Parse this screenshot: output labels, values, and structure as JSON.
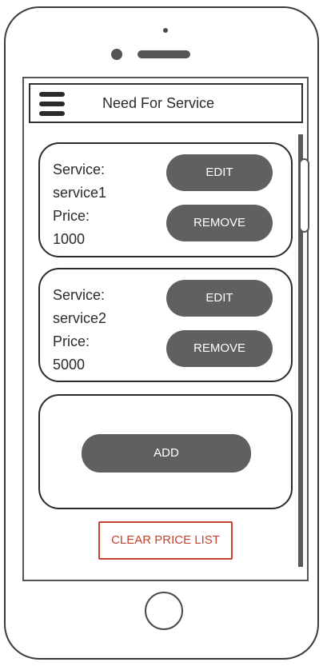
{
  "header": {
    "menu_icon": "hamburger-menu-icon",
    "title": "Need For Service"
  },
  "services": [
    {
      "service_label": "Service:",
      "service_name": "service1",
      "price_label": "Price:",
      "price": "1000",
      "edit_label": "EDIT",
      "remove_label": "REMOVE"
    },
    {
      "service_label": "Service:",
      "service_name": "service2",
      "price_label": "Price:",
      "price": "5000",
      "edit_label": "EDIT",
      "remove_label": "REMOVE"
    }
  ],
  "add_card": {
    "add_label": "ADD"
  },
  "footer": {
    "clear_label": "CLEAR PRICE LIST"
  },
  "colors": {
    "button_fill": "#606060",
    "button_text": "#ffffff",
    "clear_accent": "#c7412e",
    "outline": "#2b2b2b"
  }
}
